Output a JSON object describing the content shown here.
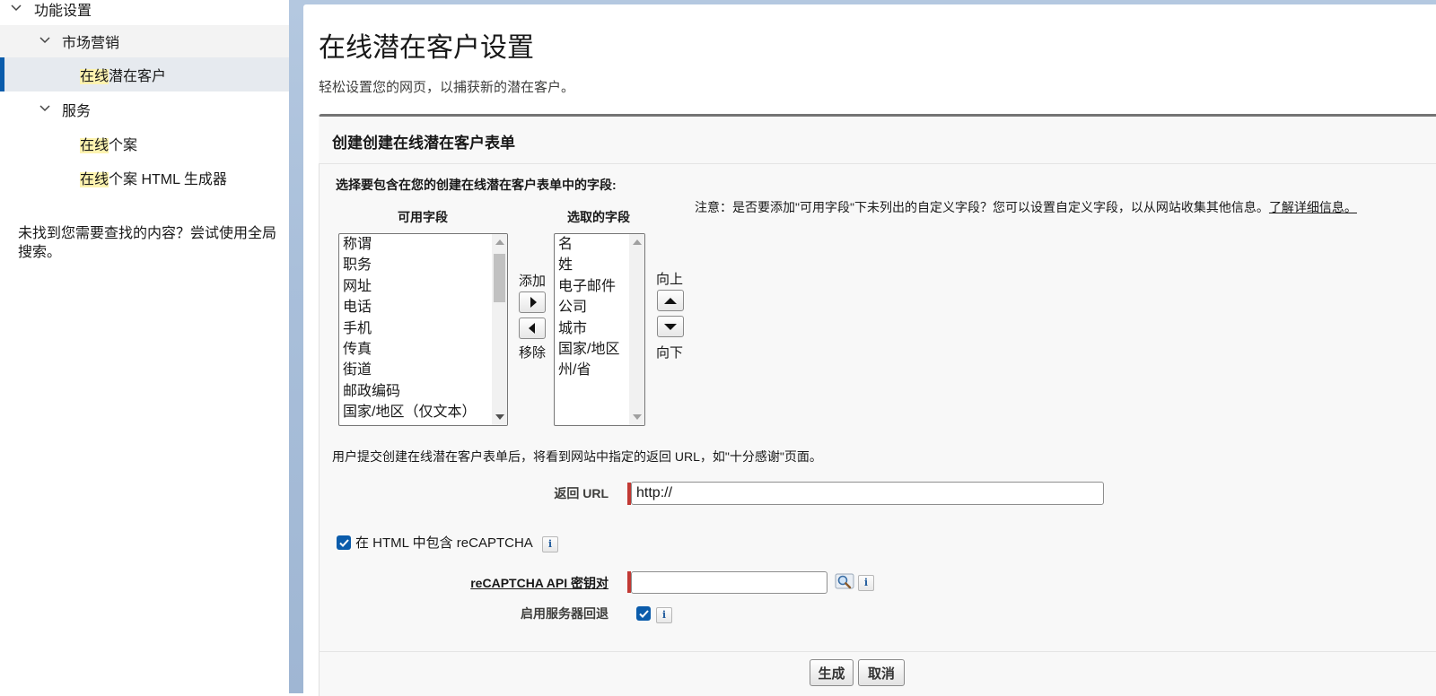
{
  "sidebar": {
    "items": [
      {
        "label": "功能设置"
      },
      {
        "label": "市场营销"
      },
      {
        "label_hl": "在线",
        "label_rest": "潜在客户"
      },
      {
        "label": "服务"
      },
      {
        "label_hl": "在线",
        "label_rest": "个案"
      },
      {
        "label_hl": "在线",
        "label_rest": "个案 HTML 生成器"
      }
    ],
    "no_result_text": "未找到您需要查找的内容？尝试使用全局搜索。"
  },
  "page": {
    "title": "在线潜在客户设置",
    "subtitle": "轻松设置您的网页，以捕获新的潜在客户。"
  },
  "panel": {
    "title": "创建创建在线潜在客户表单",
    "fields_label": "选择要包含在您的创建在线潜在客户表单中的字段:",
    "note_text": "注意：是否要添加\"可用字段\"下未列出的自定义字段？您可以设置自定义字段，以从网站收集其他信息。",
    "note_link": "了解详细信息。",
    "available_header": "可用字段",
    "selected_header": "选取的字段",
    "available_fields": [
      "称谓",
      "职务",
      "网址",
      "电话",
      "手机",
      "传真",
      "街道",
      "邮政编码",
      "国家/地区（仅文本）"
    ],
    "selected_fields": [
      "名",
      "姓",
      "电子邮件",
      "公司",
      "城市",
      "国家/地区",
      "州/省"
    ],
    "add_label": "添加",
    "remove_label": "移除",
    "up_label": "向上",
    "down_label": "向下",
    "return_note": "用户提交创建在线潜在客户表单后，将看到网站中指定的返回 URL，如\"十分感谢\"页面。",
    "return_url_label": "返回 URL",
    "return_url_value": "http://",
    "recaptcha_label": "在 HTML 中包含 reCAPTCHA",
    "recaptcha_checked": true,
    "api_key_label": "reCAPTCHA API 密钥对",
    "api_key_value": "",
    "fallback_label": "启用服务器回退",
    "fallback_checked": true,
    "info_glyph": "i"
  },
  "footer": {
    "generate_label": "生成",
    "cancel_label": "取消"
  },
  "colors": {
    "accent": "#0b5cab",
    "required": "#c23934",
    "highlight": "#fdf3b0",
    "selected_row": "#e6eaef"
  },
  "icons": [
    "chevron-down-icon",
    "caret-right-icon",
    "caret-left-icon",
    "caret-up-icon",
    "caret-down-icon",
    "lookup-icon",
    "info-icon",
    "checkmark-icon"
  ]
}
